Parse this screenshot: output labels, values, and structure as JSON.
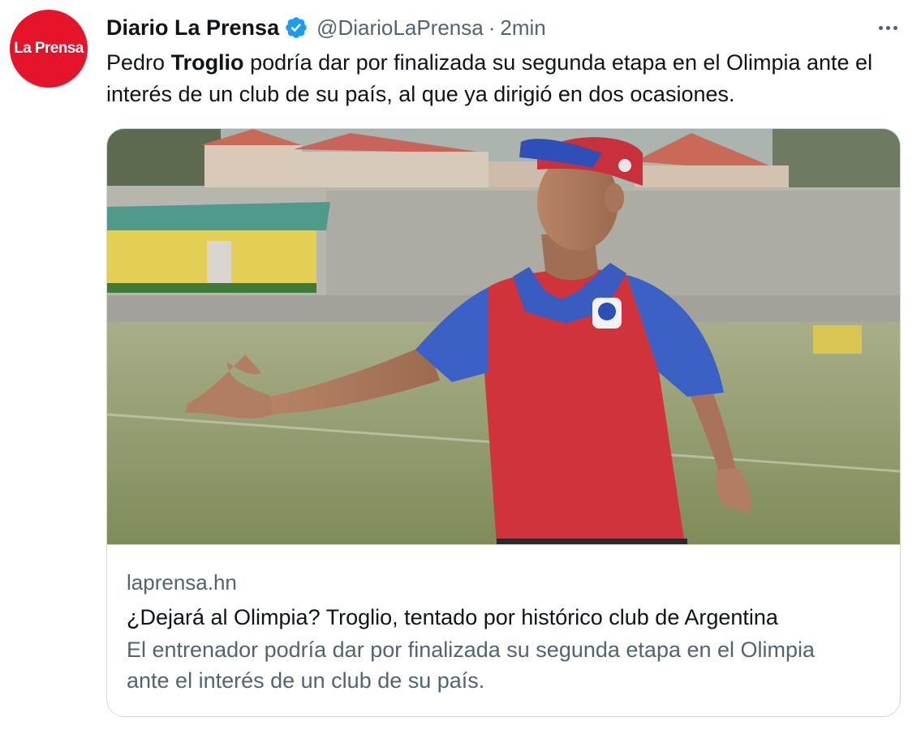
{
  "author": {
    "avatar_text": "La Prensa",
    "display_name": "Diario La Prensa",
    "handle": "@DiarioLaPrensa",
    "separator": "·",
    "time": "2min",
    "verified_icon": "verified-badge-icon"
  },
  "tweet": {
    "text_before": "Pedro ",
    "text_bold": "Troglio",
    "text_after": " podría dar por finalizada su segunda etapa en el Olimpia ante el interés de un club de su país, al que ya dirigió en dos ocasiones."
  },
  "card": {
    "domain": "laprensa.hn",
    "title": "¿Dejará al Olimpia? Troglio, tentado por histórico club de Argentina",
    "description": "El entrenador podría dar por finalizada su segunda etapa en el Olimpia ante el interés de un club de su país."
  },
  "colors": {
    "brand_red": "#e5142a",
    "verified_blue": "#1d9bf0",
    "secondary_text": "#536471",
    "border": "#cfd9de"
  }
}
